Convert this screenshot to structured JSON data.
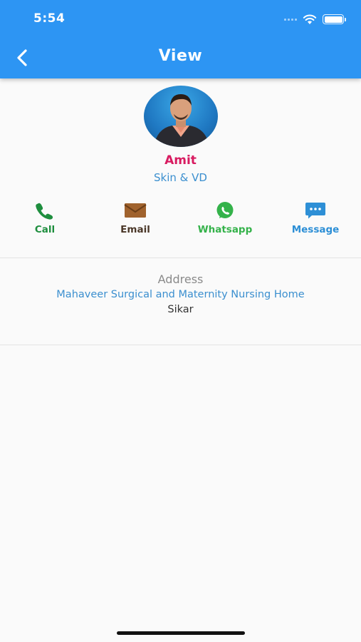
{
  "status_bar": {
    "time": "5:54"
  },
  "header": {
    "title": "View"
  },
  "profile": {
    "name": "Amit",
    "speciality": "Skin & VD"
  },
  "actions": [
    {
      "label": "Call",
      "icon": "phone-icon",
      "color": "#1e8e3e"
    },
    {
      "label": "Email",
      "icon": "envelope-icon",
      "color": "#4a3728"
    },
    {
      "label": "Whatsapp",
      "icon": "whatsapp-icon",
      "color": "#34b24a"
    },
    {
      "label": "Message",
      "icon": "message-bubble-icon",
      "color": "#2d8fd6"
    }
  ],
  "address": {
    "heading": "Address",
    "line1": "Mahaveer Surgical and Maternity Nursing Home",
    "city": "Sikar"
  },
  "colors": {
    "app_bar": "#2d95f3",
    "name": "#d81b60",
    "link_blue": "#3b8fcf"
  }
}
